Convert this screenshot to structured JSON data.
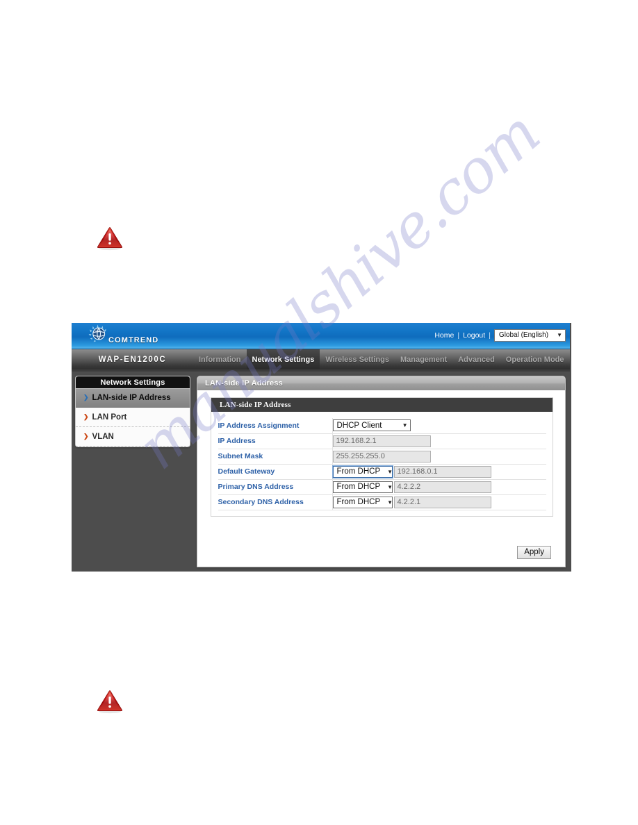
{
  "page": {
    "warning_icon_name": "red-warning-triangle"
  },
  "router_ui": {
    "header": {
      "brand_name": "COMTREND",
      "logo_icon": "comtrend-globe-logo",
      "home_label": "Home",
      "separator": "|",
      "logout_label": "Logout",
      "language_value": "Global (English)",
      "language_caret": "▼"
    },
    "nav": {
      "model_name": "WAP-EN1200C",
      "tabs": [
        {
          "label": "Information",
          "active": false
        },
        {
          "label": "Network Settings",
          "active": true
        },
        {
          "label": "Wireless Settings",
          "active": false
        },
        {
          "label": "Management",
          "active": false
        },
        {
          "label": "Advanced",
          "active": false
        },
        {
          "label": "Operation Mode",
          "active": false
        }
      ]
    },
    "sidebar": {
      "title": "Network Settings",
      "items": [
        {
          "label": "LAN-side IP Address",
          "arrow": "❯",
          "selected": true
        },
        {
          "label": "LAN Port",
          "arrow": "❯",
          "selected": false
        },
        {
          "label": "VLAN",
          "arrow": "❯",
          "selected": false
        }
      ]
    },
    "content": {
      "title": "LAN-side IP Address",
      "panel_header": "LAN-side IP Address",
      "rows": [
        {
          "label": "IP Address Assignment",
          "control": "select",
          "select_value": "DHCP Client",
          "caret": "▼"
        },
        {
          "label": "IP Address",
          "control": "input",
          "input_value": "192.168.2.1"
        },
        {
          "label": "Subnet Mask",
          "control": "input",
          "input_value": "255.255.255.0"
        },
        {
          "label": "Default Gateway",
          "control": "select+input",
          "select_value": "From DHCP",
          "caret": "▼",
          "input_value": "192.168.0.1"
        },
        {
          "label": "Primary DNS Address",
          "control": "select+input",
          "select_value": "From DHCP",
          "caret": "▼",
          "input_value": "4.2.2.2"
        },
        {
          "label": "Secondary DNS Address",
          "control": "select+input",
          "select_value": "From DHCP",
          "caret": "▼",
          "input_value": "4.2.2.1"
        }
      ],
      "apply_label": "Apply"
    }
  },
  "watermark": {
    "text": "manualshive.com"
  },
  "colors": {
    "header_blue": "#1275c6",
    "nav_dark": "#3a3a3a",
    "label_blue": "#2f62a8",
    "sidebar_arrow": "#cc4a18",
    "warning_red": "#c81414",
    "body_gray": "#4d4d4d"
  }
}
